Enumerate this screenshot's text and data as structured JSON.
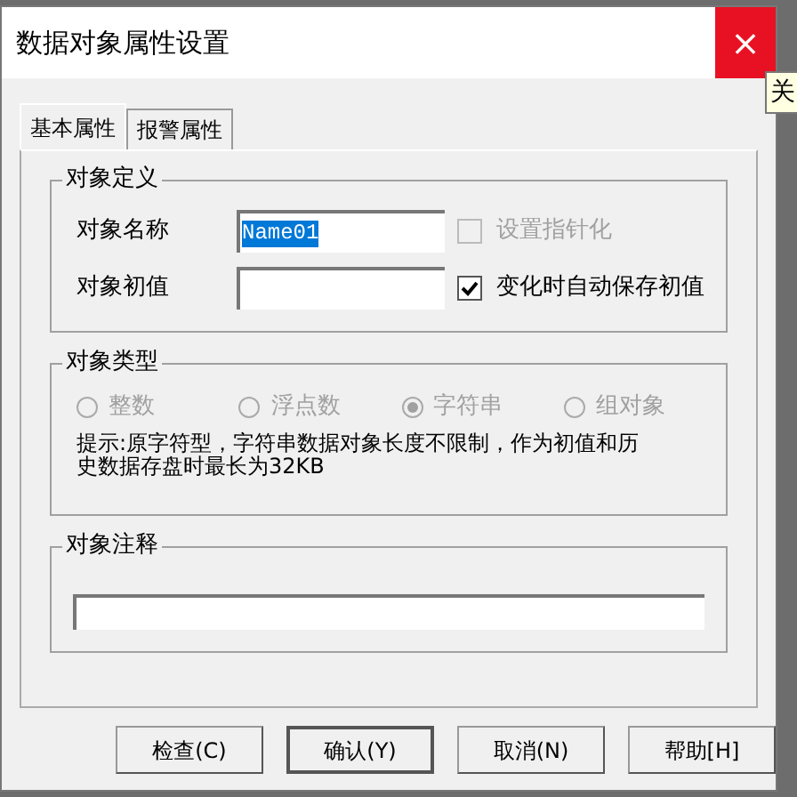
{
  "window": {
    "title": "数据对象属性设置",
    "close": "×"
  },
  "tooltip": "关",
  "tabs": [
    {
      "label": "基本属性",
      "selected": true
    },
    {
      "label": "报警属性",
      "selected": false
    }
  ],
  "definition": {
    "title": "对象定义",
    "name_label": "对象名称",
    "name_value": "Name01",
    "pointer_checkbox": {
      "label": "设置指针化",
      "checked": false,
      "disabled": true
    },
    "initial_label": "对象初值",
    "autosave_checkbox": {
      "label": "变化时自动保存初值",
      "checked": true,
      "disabled": false
    }
  },
  "type": {
    "title": "对象类型",
    "options": [
      {
        "label": "整数",
        "selected": false
      },
      {
        "label": "浮点数",
        "selected": false
      },
      {
        "label": "字符串",
        "selected": true
      },
      {
        "label": "组对象",
        "selected": false
      }
    ],
    "hint": "提示:原字符型，字符串数据对象长度不限制，作为初值和历史数据存盘时最长为32KB"
  },
  "comment": {
    "title": "对象注释"
  },
  "buttons": [
    {
      "label": "检查(C)",
      "default": false
    },
    {
      "label": "确认(Y)",
      "default": true
    },
    {
      "label": "取消(N)",
      "default": false
    },
    {
      "label": "帮助[H]",
      "default": false
    }
  ]
}
